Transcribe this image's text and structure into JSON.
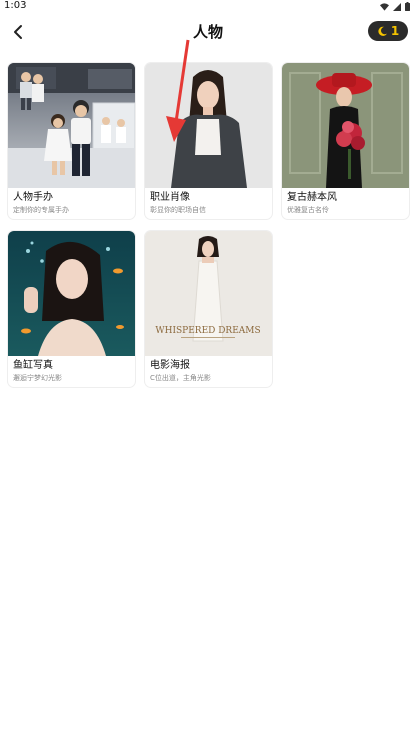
{
  "status": {
    "time": "1:03"
  },
  "header": {
    "title": "人物",
    "back_icon": "chevron-left-icon",
    "credits": "1",
    "credit_icon": "moon-icon"
  },
  "colors": {
    "accent": "#f5c400",
    "badge_bg": "#2b2b2b",
    "arrow": "#e53935"
  },
  "cards": [
    {
      "title": "人物手办",
      "subtitle": "定制你的专属手办",
      "image": "figurine-kids-photo"
    },
    {
      "title": "职业肖像",
      "subtitle": "彰显你的职场自信",
      "image": "business-woman-portrait"
    },
    {
      "title": "复古赫本风",
      "subtitle": "优雅复古名伶",
      "image": "red-hat-woman-portrait"
    },
    {
      "title": "鱼缸写真",
      "subtitle": "邂逅宁梦幻光影",
      "image": "aquarium-woman-portrait"
    },
    {
      "title": "电影海报",
      "subtitle": "C位出道，主角光影",
      "image": "movie-poster-woman",
      "poster_text": "WHISPERED DREAMS"
    }
  ]
}
